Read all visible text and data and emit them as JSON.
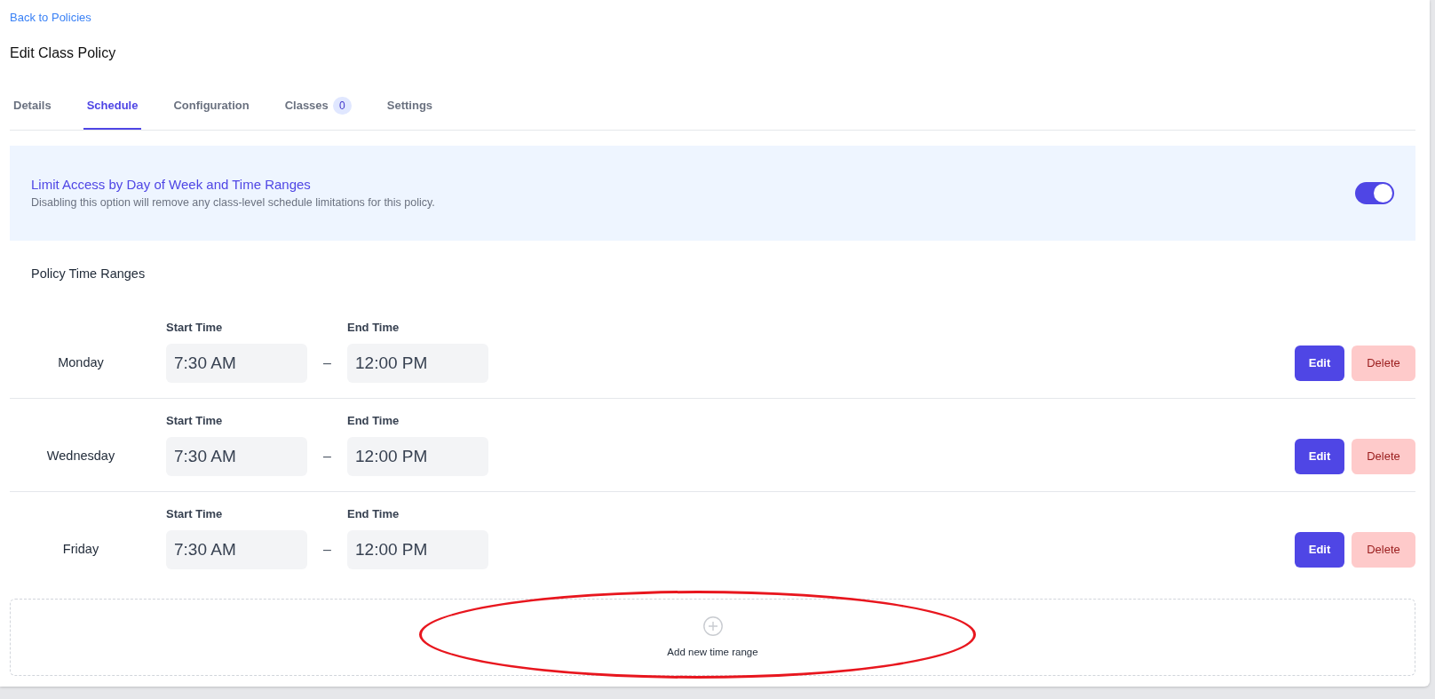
{
  "back_link": "Back to Policies",
  "page_title": "Edit Class Policy",
  "tabs": [
    {
      "label": "Details",
      "selected": false
    },
    {
      "label": "Schedule",
      "selected": true
    },
    {
      "label": "Configuration",
      "selected": false
    },
    {
      "label": "Classes",
      "badge": "0",
      "selected": false
    },
    {
      "label": "Settings",
      "selected": false
    }
  ],
  "schedule_option": {
    "title": "Limit Access by Day of Week and Time Ranges",
    "description": "Disabling this option will remove any class-level schedule limitations for this policy.",
    "on": true
  },
  "section_title": "Policy Time Ranges",
  "time_ranges": [
    {
      "day": "Monday",
      "start_label": "Start Time",
      "start_value": "7:30 AM",
      "separator": "–",
      "end_label": "End Time",
      "end_value": "12:00 PM",
      "edit_label": "Edit",
      "delete_label": "Delete"
    },
    {
      "day": "Wednesday",
      "start_label": "Start Time",
      "start_value": "7:30 AM",
      "separator": "–",
      "end_label": "End Time",
      "end_value": "12:00 PM",
      "edit_label": "Edit",
      "delete_label": "Delete"
    },
    {
      "day": "Friday",
      "start_label": "Start Time",
      "start_value": "7:30 AM",
      "separator": "–",
      "end_label": "End Time",
      "end_value": "12:00 PM",
      "edit_label": "Edit",
      "delete_label": "Delete"
    }
  ],
  "add_button": {
    "label": "Add new time range"
  }
}
